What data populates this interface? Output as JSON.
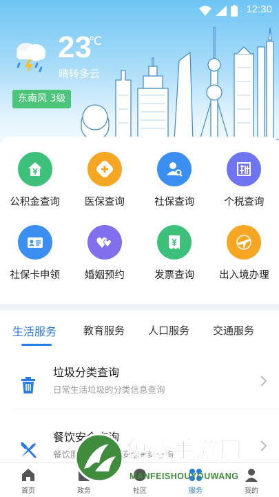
{
  "status_bar": {
    "time": "12:30",
    "icons": [
      "wifi-icon",
      "signal-icon",
      "battery-icon"
    ]
  },
  "weather": {
    "temperature": "23",
    "unit": "℃",
    "description": "晴转多云",
    "wind": "东南风 3级",
    "icon": "cloud-rain-lightning-icon"
  },
  "services": [
    {
      "label": "公积金查询",
      "icon": "house-yen-icon",
      "color": "#3cc07a"
    },
    {
      "label": "医保查询",
      "icon": "medical-plus-icon",
      "color": "#f5a623"
    },
    {
      "label": "社保查询",
      "icon": "user-search-icon",
      "color": "#3a8ff0"
    },
    {
      "label": "个税查询",
      "icon": "tax-icon",
      "color": "#6f74f0"
    },
    {
      "label": "社保卡申领",
      "icon": "id-card-icon",
      "color": "#3a8ff0"
    },
    {
      "label": "婚姻预约",
      "icon": "hearts-icon",
      "color": "#8070ee"
    },
    {
      "label": "发票查询",
      "icon": "invoice-icon",
      "color": "#3cc07a"
    },
    {
      "label": "出入境办理",
      "icon": "airplane-icon",
      "color": "#f5a623"
    }
  ],
  "tabs": {
    "items": [
      "生活服务",
      "教育服务",
      "人口服务",
      "交通服务"
    ],
    "active": "生活服务",
    "accent": "#2b7be5"
  },
  "list": [
    {
      "title": "垃圾分类查询",
      "subtitle": "日常生活垃圾的分类信息查询",
      "icon": "trash-icon"
    },
    {
      "title": "餐饮安全查询",
      "subtitle": "餐饮服务单位食品安全等级查询",
      "icon": "fork-knife-icon"
    }
  ],
  "bottom_nav": [
    {
      "label": "首页",
      "icon": "home-icon"
    },
    {
      "label": "政务",
      "icon": "government-icon"
    },
    {
      "label": "社区",
      "icon": "community-icon"
    },
    {
      "label": "服务",
      "icon": "service-icon"
    },
    {
      "label": "我的",
      "icon": "user-icon"
    }
  ],
  "bottom_nav_active": "服务",
  "watermark": {
    "title": "免费手游网",
    "url": "MANFEISHOUYOUWANG"
  }
}
